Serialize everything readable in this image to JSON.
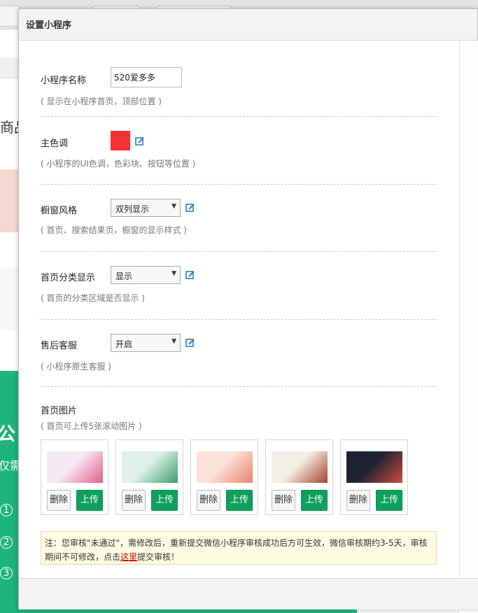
{
  "dialog": {
    "title": "设置小程序"
  },
  "name_field": {
    "label": "小程序名称",
    "value": "520爱多多",
    "hint": "( 显示在小程序首页，顶部位置 )"
  },
  "theme_color": {
    "label": "主色调",
    "color": "#f43232",
    "hint": "( 小程序的UI色调，色彩块、按钮等位置 )"
  },
  "window_style": {
    "label": "橱窗风格",
    "selected": "双列显示",
    "hint": "( 首页、搜索结果页，橱窗的显示样式 )"
  },
  "home_category": {
    "label": "首页分类显示",
    "selected": "显示",
    "hint": "( 首页的分类区域是否显示 )"
  },
  "after_sale": {
    "label": "售后客服",
    "selected": "开启",
    "hint": "( 小程序原生客服 )"
  },
  "home_images": {
    "label": "首页图片",
    "hint": "( 首页可上传5张滚动图片 )",
    "delete_label": "删除",
    "upload_label": "上传",
    "images": [
      {
        "name": "banner-1",
        "colors": [
          "#f6e9f2",
          "#e05d8a"
        ]
      },
      {
        "name": "banner-2",
        "colors": [
          "#dff1ea",
          "#3a9e6a"
        ]
      },
      {
        "name": "banner-3",
        "colors": [
          "#fbe1d8",
          "#e9836c"
        ]
      },
      {
        "name": "banner-4",
        "colors": [
          "#f4efe6",
          "#a3432c"
        ]
      },
      {
        "name": "banner-5",
        "colors": [
          "#1e2233",
          "#d24d3a"
        ]
      }
    ]
  },
  "notice": {
    "before": "注：您审核\"未通过\"，需修改后，重新提交微信小程序审核成功后方可生效，微信审核期约3-5天，审核期间不可修改，点击",
    "link": "这里",
    "after": "提交审核！"
  },
  "background": {
    "left_text": "商品",
    "green_text": "公",
    "green_sub": "仅需",
    "steps": [
      "1",
      "2",
      "3"
    ]
  }
}
